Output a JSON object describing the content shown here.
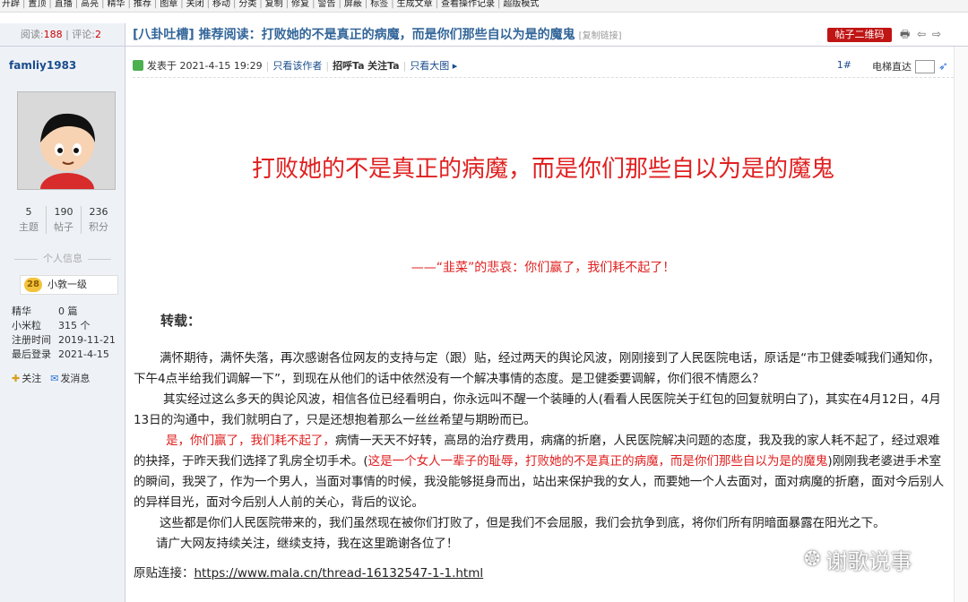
{
  "toolbar": {
    "items": [
      "开辟",
      "置顶",
      "直播",
      "高亮",
      "精华",
      "推荐",
      "图章",
      "关闭",
      "移动",
      "分类",
      "复制",
      "修复",
      "警告",
      "屏蔽",
      "标签",
      "生成文章",
      "查看操作记录",
      "超版模式"
    ]
  },
  "stats": {
    "read_label": "阅读:",
    "read_value": "188",
    "reply_label": "评论:",
    "reply_value": "2"
  },
  "thread": {
    "title": "[八卦吐槽] 推荐阅读：打败她的不是真正的病魔，而是你们那些自以为是的魔鬼",
    "copy_link": "[复制链接]",
    "qr_button": "帖子二维码",
    "icons": [
      "print-icon",
      "prev-icon",
      "next-icon"
    ]
  },
  "user": {
    "name": "famliy1983",
    "counts": [
      {
        "value": "5",
        "label": "主题"
      },
      {
        "value": "190",
        "label": "帖子"
      },
      {
        "value": "236",
        "label": "积分"
      }
    ],
    "info_title": "个人信息",
    "level_badge": "28",
    "level_name": "小敦一级",
    "details": [
      {
        "k": "精华",
        "v": "0 篇"
      },
      {
        "k": "小米粒",
        "v": "315 个"
      },
      {
        "k": "注册时间",
        "v": "2019-11-21"
      },
      {
        "k": "最后登录",
        "v": "2021-4-15"
      }
    ],
    "follow": "关注",
    "message": "发消息"
  },
  "post": {
    "posted": "发表于 2021-4-15 19:29",
    "only_author": "只看该作者",
    "greet": "招呼Ta",
    "follow": "关注Ta",
    "big_image": "只看大图 ▸",
    "floor": "1#",
    "elevator": "电梯直达",
    "headline": "打败她的不是真正的病魔，而是你们那些自以为是的魔鬼",
    "subhead": "——“韭菜”的悲哀：你们赢了，我们耗不起了！",
    "repost": "转载：",
    "p1": "满怀期待，满怀失落，再次感谢各位网友的支持与定（跟）贴，经过两天的舆论风波，刚刚接到了人民医院电话，原话是“市卫健委喊我们通知你，下午4点半给我们调解一下”，到现在从他们的话中依然没有一个解决事情的态度。是卫健委要调解，你们很不情愿么？",
    "p2": "其实经过这么多天的舆论风波，相信各位已经看明白，你永远叫不醒一个装睡的人(看看人民医院关于红包的回复就明白了)，其实在4月12日，4月13日的沟通中，我们就明白了，只是还想抱着那么一丝丝希望与期盼而已。",
    "p3_red": "是，你们赢了，我们耗不起了，",
    "p3_a": "病情一天天不好转，高昂的治疗费用，病痛的折磨，人民医院解决问题的态度，我及我的家人耗不起了，经过艰难的抉择，于昨天我们选择了乳房全切手术。(",
    "p3_red2": "这是一个女人一辈子的耻辱，打败她的不是真正的病魔，而是你们那些自以为是的魔鬼",
    "p3_b": ")刚刚我老婆进手术室的瞬间，我哭了，作为一个男人，当面对事情的时候，我没能够挺身而出，站出来保护我的女人，而要她一个人去面对，面对病魔的折磨，面对今后别人的异样目光，面对今后别人人前的关心，背后的议论。",
    "p4": "这些都是你们人民医院带来的，我们虽然现在被你们打败了，但是我们不会屈服，我们会抗争到底，将你们所有阴暗面暴露在阳光之下。",
    "p5": "请广大网友持续关注，继续支持，我在这里跪谢各位了！",
    "src_label": "原贴连接：",
    "src_url": "https://www.mala.cn/thread-16132547-1-1.html"
  },
  "watermark": "谢歌说事"
}
